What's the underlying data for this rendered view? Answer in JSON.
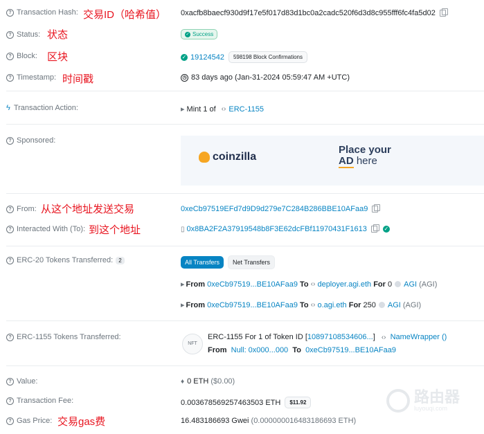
{
  "labels": {
    "tx_hash": "Transaction Hash:",
    "status": "Status:",
    "block": "Block:",
    "timestamp": "Timestamp:",
    "tx_action": "Transaction Action:",
    "sponsored": "Sponsored:",
    "from": "From:",
    "interacted": "Interacted With (To):",
    "erc20": "ERC-20 Tokens Transferred:",
    "erc1155": "ERC-1155 Tokens Transferred:",
    "value": "Value:",
    "tx_fee": "Transaction Fee:",
    "gas_price": "Gas Price:"
  },
  "annotations": {
    "tx_hash": "交易ID（哈希值）",
    "status": "状态",
    "block": "区块",
    "timestamp": "时间戳",
    "from": "从这个地址发送交易",
    "interacted": "到这个地址",
    "gas_price": "交易gas费"
  },
  "values": {
    "tx_hash": "0xacfb8baecf930d9f17e5f017d83d1bc0a2cadc520f6d3d8c955fff6fc4fa5d02",
    "status": "Success",
    "block_number": "19124542",
    "block_confirmations": "598198 Block Confirmations",
    "timestamp": "83 days ago (Jan-31-2024 05:59:47 AM +UTC)",
    "action_prefix": "Mint 1 of",
    "action_token": "ERC-1155",
    "from": "0xeCb97519EFd7d9D9d279e7C284B286BBE10AFaa9",
    "to": "0x8BA2F2A37919548b8F3E62dcFBf11970431F1613",
    "erc20_count": "2",
    "value": "0 ETH",
    "value_usd": "($0.00)",
    "tx_fee": "0.003678569257463503 ETH",
    "tx_fee_usd": "$11.92",
    "gas_price": "16.483186693 Gwei",
    "gas_price_eth": "(0.000000016483186693 ETH)"
  },
  "ad": {
    "brand": "coinzilla",
    "line1": "Place your",
    "line2_a": "AD",
    "line2_b": " here"
  },
  "erc20_tabs": {
    "all": "All Transfers",
    "net": "Net Transfers"
  },
  "erc20_transfers": [
    {
      "from_label": "From",
      "from": "0xeCb97519...BE10AFaa9",
      "to_label": "To",
      "to": "deployer.agi.eth",
      "for_label": "For",
      "amount": "0",
      "token": "AGI",
      "symbol": "(AGI)"
    },
    {
      "from_label": "From",
      "from": "0xeCb97519...BE10AFaa9",
      "to_label": "To",
      "to": "o.agi.eth",
      "for_label": "For",
      "amount": "250",
      "token": "AGI",
      "symbol": "(AGI)"
    }
  ],
  "erc1155": {
    "icon_text": "NFT",
    "line1_prefix": "ERC-1155 For 1 of Token ID [",
    "token_id": "10897108534606...",
    "line1_suffix": "]",
    "contract": "NameWrapper ()",
    "from_label": "From",
    "from": "Null: 0x000...000",
    "to_label": "To",
    "to": "0xeCb97519...BE10AFaa9"
  },
  "watermark": {
    "title": "路由器",
    "sub": "luyouqi.com"
  },
  "colors": {
    "link": "#0784c3",
    "success": "#00a186",
    "annotation": "#e8141f"
  }
}
